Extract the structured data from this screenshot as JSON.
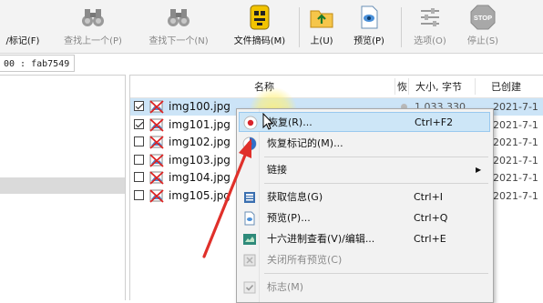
{
  "toolbar": {
    "items": [
      {
        "label": "/标记(F)",
        "icon": "mark-icon",
        "enabled": true
      },
      {
        "label": "查找上一个(P)",
        "icon": "find-previous-binoculars-icon",
        "enabled": false
      },
      {
        "label": "查找下一个(N)",
        "icon": "find-next-binoculars-icon",
        "enabled": false
      },
      {
        "label": "文件摘码(M)",
        "icon": "file-carving-icon",
        "enabled": true
      },
      {
        "label": "上(U)",
        "icon": "up-folder-icon",
        "enabled": true
      },
      {
        "label": "预览(P)",
        "icon": "preview-icon",
        "enabled": true
      },
      {
        "label": "选项(O)",
        "icon": "options-sliders-icon",
        "enabled": false
      },
      {
        "label": "停止(S)",
        "icon": "stop-sign-icon",
        "enabled": false
      }
    ],
    "stop_sign_text": "STOP"
  },
  "address": {
    "value": "00 : fab7549"
  },
  "file_list": {
    "columns": {
      "name": "名称",
      "flag": "恢",
      "size": "大小, 字节",
      "created": "已创建"
    },
    "rows": [
      {
        "name": "img100.jpg",
        "checked": true,
        "size": "1,033,330",
        "created": "2021-7-1",
        "selected": true
      },
      {
        "name": "img101.jpg",
        "checked": true,
        "size": "",
        "created": "2021-7-1",
        "selected": false
      },
      {
        "name": "img102.jpg",
        "checked": false,
        "size": "",
        "created": "2021-7-1",
        "selected": false
      },
      {
        "name": "img103.jpg",
        "checked": false,
        "size": "",
        "created": "2021-7-1",
        "selected": false
      },
      {
        "name": "img104.jpg",
        "checked": false,
        "size": "",
        "created": "2021-7-1",
        "selected": false
      },
      {
        "name": "img105.jpg",
        "checked": false,
        "size": "",
        "created": "2021-7-1",
        "selected": false
      }
    ]
  },
  "context_menu": {
    "items": [
      {
        "label": "恢复(R)...",
        "shortcut": "Ctrl+F2",
        "icon": "recover-icon",
        "highlighted": true,
        "disabled": false
      },
      {
        "label": "恢复标记的(M)...",
        "shortcut": "",
        "icon": "recover-marked-icon",
        "highlighted": false,
        "disabled": false
      },
      {
        "label": "链接",
        "shortcut": "",
        "icon": "",
        "submenu": true,
        "highlighted": false,
        "disabled": false
      },
      {
        "label": "获取信息(G)",
        "shortcut": "Ctrl+I",
        "icon": "info-icon",
        "highlighted": false,
        "disabled": false
      },
      {
        "label": "预览(P)...",
        "shortcut": "Ctrl+Q",
        "icon": "preview-small-icon",
        "highlighted": false,
        "disabled": false
      },
      {
        "label": "十六进制查看(V)/编辑...",
        "shortcut": "Ctrl+E",
        "icon": "hex-view-icon",
        "highlighted": false,
        "disabled": false
      },
      {
        "label": "关闭所有预览(C)",
        "shortcut": "",
        "icon": "close-previews-icon",
        "highlighted": false,
        "disabled": true
      },
      {
        "label": "标志(M)",
        "shortcut": "",
        "icon": "checkmark-icon",
        "highlighted": false,
        "disabled": true
      }
    ],
    "submenu_arrow": "▶"
  },
  "colors": {
    "selection": "#cce4f7",
    "menu_highlight": "#cde6f7",
    "annotation_arrow": "#e0302a"
  }
}
